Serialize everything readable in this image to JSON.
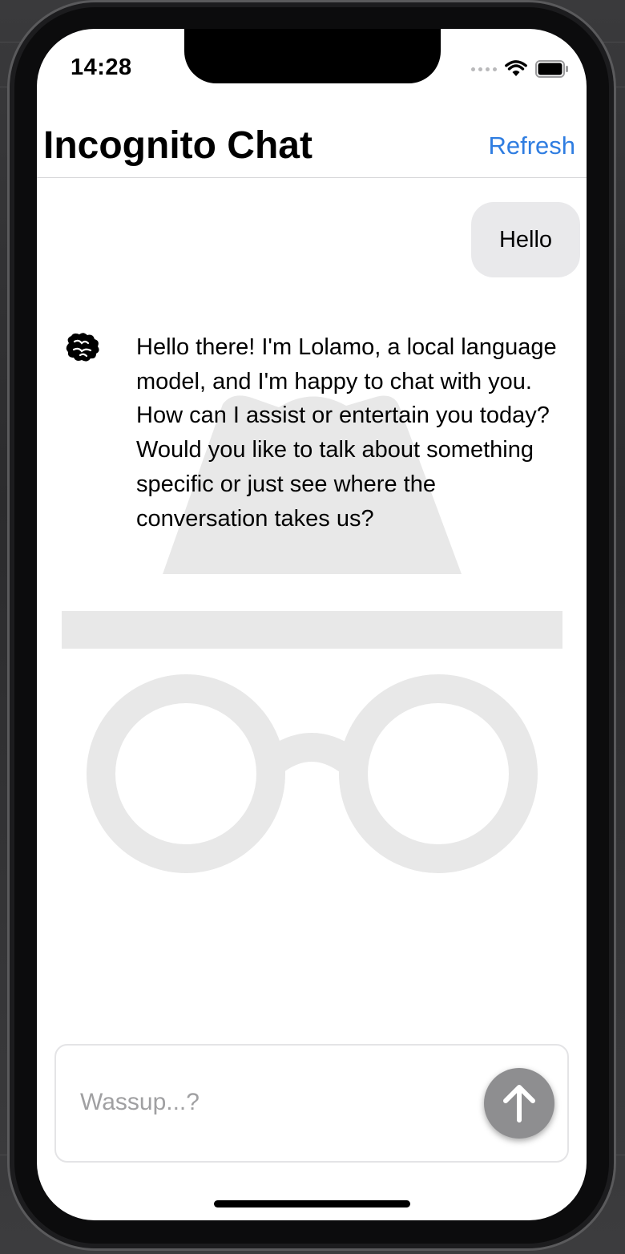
{
  "status_bar": {
    "time": "14:28",
    "icons": [
      "cellular-signal-icon",
      "wifi-icon",
      "battery-icon"
    ]
  },
  "nav": {
    "title": "Incognito Chat",
    "refresh_label": "Refresh"
  },
  "messages": [
    {
      "role": "user",
      "text": "Hello"
    },
    {
      "role": "assistant",
      "avatar_icon": "brain-icon",
      "text": "Hello there! I'm Lolamo, a local language model, and I'm happy to chat with you. How can I assist or entertain you today? Would you like to talk about something specific or just see where the conversation takes us?"
    }
  ],
  "composer": {
    "value": "",
    "placeholder": "Wassup...?",
    "send_icon": "arrow-up-icon"
  },
  "watermark_icon": "incognito-hat-glasses-icon",
  "colors": {
    "accent": "#2f7de1",
    "user_bubble": "#e9e9eb",
    "send_button": "#8e8e90",
    "watermark": "#e8e8e8"
  }
}
